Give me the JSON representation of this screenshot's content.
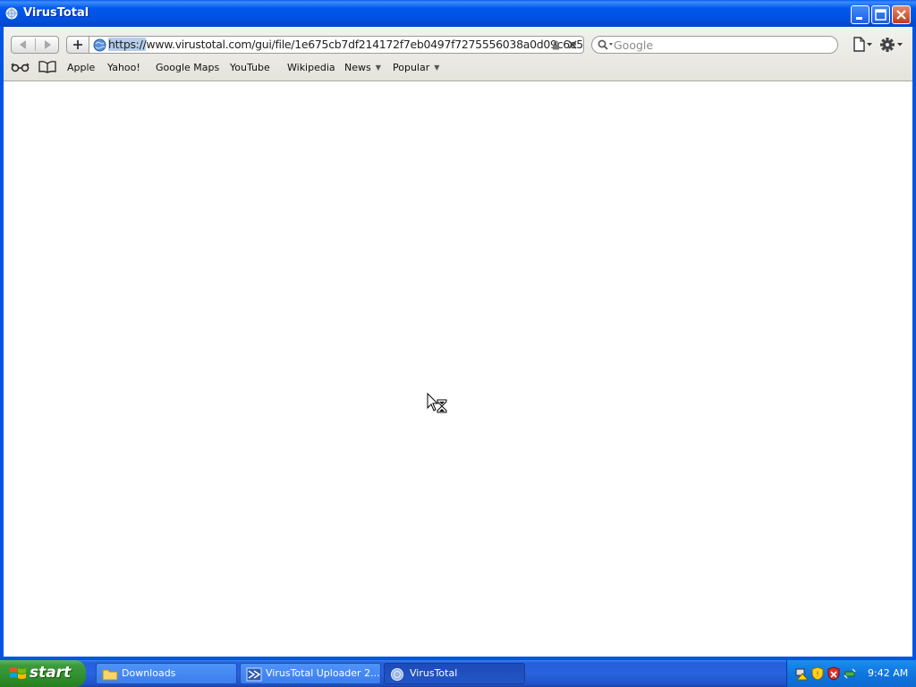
{
  "window": {
    "title": "VirusTotal"
  },
  "toolbar": {
    "url_prefix": "https://",
    "url_rest": "www.virustotal.com/gui/file/1e675cb7df214172f7eb0497f7275556038a0d09c6e5",
    "search_placeholder": "Google"
  },
  "bookmarks": {
    "items": [
      {
        "label": "Apple"
      },
      {
        "label": "Yahoo!"
      },
      {
        "label": "Google Maps"
      },
      {
        "label": "YouTube"
      },
      {
        "label": "Wikipedia"
      },
      {
        "label": "News"
      },
      {
        "label": "Popular"
      }
    ]
  },
  "taskbar": {
    "start_label": "start",
    "tasks": [
      {
        "label": "Downloads",
        "icon": "folder-icon"
      },
      {
        "label": "VirusTotal Uploader 2...",
        "icon": "virustotal-uploader-icon"
      },
      {
        "label": "VirusTotal",
        "icon": "safari-icon"
      }
    ],
    "clock": "9:42 AM"
  },
  "colors": {
    "title_bar": "#0058ee",
    "taskbar": "#245edb",
    "start_button": "#3c9a3a",
    "url_highlight": "#b5cdea"
  }
}
